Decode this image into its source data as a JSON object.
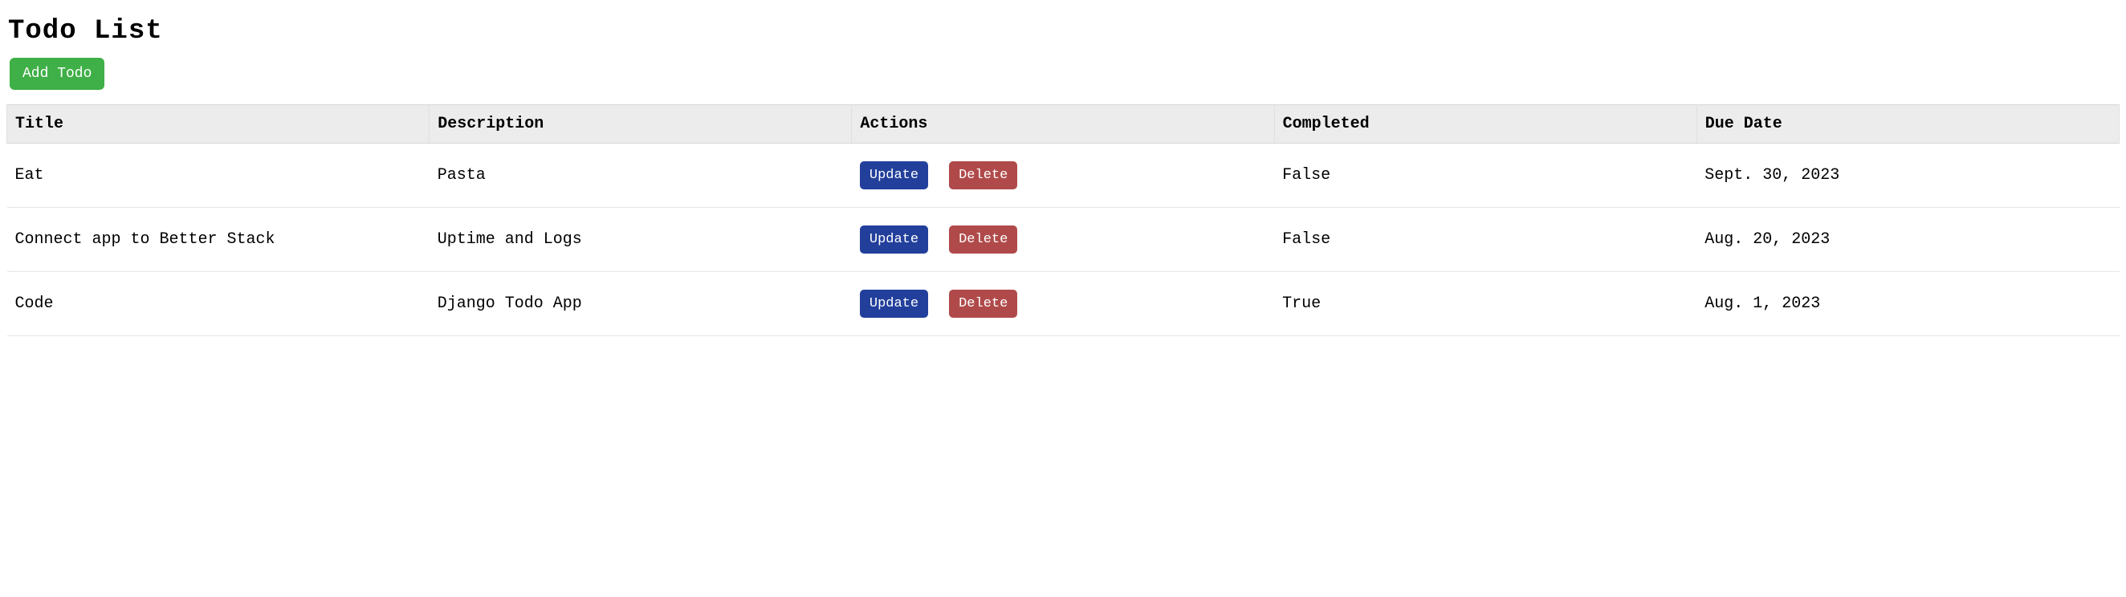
{
  "page": {
    "title": "Todo List"
  },
  "buttons": {
    "add": "Add Todo",
    "update": "Update",
    "delete": "Delete"
  },
  "table": {
    "headers": {
      "title": "Title",
      "description": "Description",
      "actions": "Actions",
      "completed": "Completed",
      "due_date": "Due Date"
    },
    "rows": [
      {
        "title": "Eat",
        "description": "Pasta",
        "completed": "False",
        "due_date": "Sept. 30, 2023"
      },
      {
        "title": "Connect app to Better Stack",
        "description": "Uptime and Logs",
        "completed": "False",
        "due_date": "Aug. 20, 2023"
      },
      {
        "title": "Code",
        "description": "Django Todo App",
        "completed": "True",
        "due_date": "Aug. 1, 2023"
      }
    ]
  }
}
